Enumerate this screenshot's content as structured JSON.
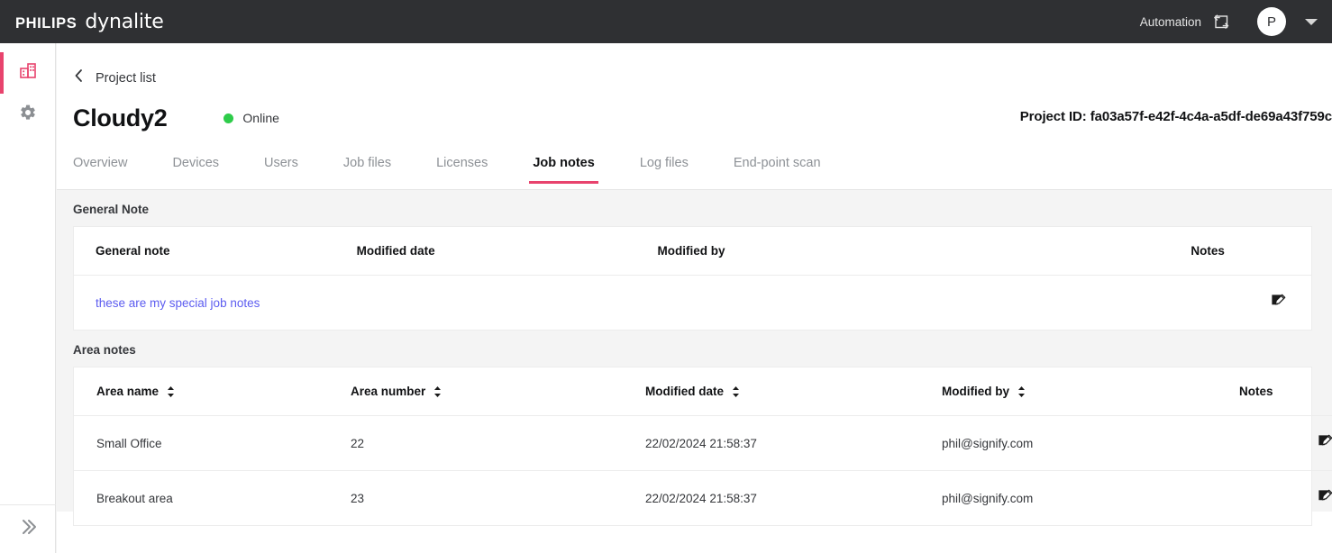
{
  "topbar": {
    "brand_philips": "PHILIPS",
    "brand_product": "dynalite",
    "automation_label": "Automation",
    "swap_icon": "swap-environment-icon",
    "avatar_initial": "P",
    "caret_icon": "chevron-down-icon"
  },
  "rail": {
    "items": [
      {
        "name": "projects",
        "icon": "building-icon",
        "active": true
      },
      {
        "name": "settings",
        "icon": "gear-icon",
        "active": false
      }
    ],
    "expand_icon": "chevrons-right-icon"
  },
  "header": {
    "back_icon": "chevron-left-icon",
    "breadcrumb": "Project list",
    "project_title": "Cloudy2",
    "status": "Online",
    "status_color": "#2ecc4a",
    "project_id": "Project ID: fa03a57f-e42f-4c4a-a5df-de69a43f759c"
  },
  "tabs": {
    "accent_color": "#e8436d",
    "items": [
      {
        "label": "Overview",
        "active": false
      },
      {
        "label": "Devices",
        "active": false
      },
      {
        "label": "Users",
        "active": false
      },
      {
        "label": "Job files",
        "active": false
      },
      {
        "label": "Licenses",
        "active": false
      },
      {
        "label": "Job notes",
        "active": true
      },
      {
        "label": "Log files",
        "active": false
      },
      {
        "label": "End-point scan",
        "active": false
      }
    ]
  },
  "general_note": {
    "section_title": "General Note",
    "columns": [
      "General note",
      "Modified date",
      "Modified by",
      "Notes"
    ],
    "rows": [
      {
        "note": "these are my special job notes",
        "modified_date": "",
        "modified_by": "",
        "notes_icon": "edit-note-icon"
      }
    ]
  },
  "area_notes": {
    "section_title": "Area notes",
    "columns": [
      {
        "label": "Area name",
        "sortable": true
      },
      {
        "label": "Area number",
        "sortable": true
      },
      {
        "label": "Modified date",
        "sortable": true
      },
      {
        "label": "Modified by",
        "sortable": true
      },
      {
        "label": "Notes",
        "sortable": false
      }
    ],
    "rows": [
      {
        "area_name": "Small Office",
        "area_number": "22",
        "modified_date": "22/02/2024 21:58:37",
        "modified_by": "phil@signify.com",
        "notes_icon": "edit-note-icon"
      },
      {
        "area_name": "Breakout area",
        "area_number": "23",
        "modified_date": "22/02/2024 21:58:37",
        "modified_by": "phil@signify.com",
        "notes_icon": "edit-note-icon"
      }
    ]
  }
}
